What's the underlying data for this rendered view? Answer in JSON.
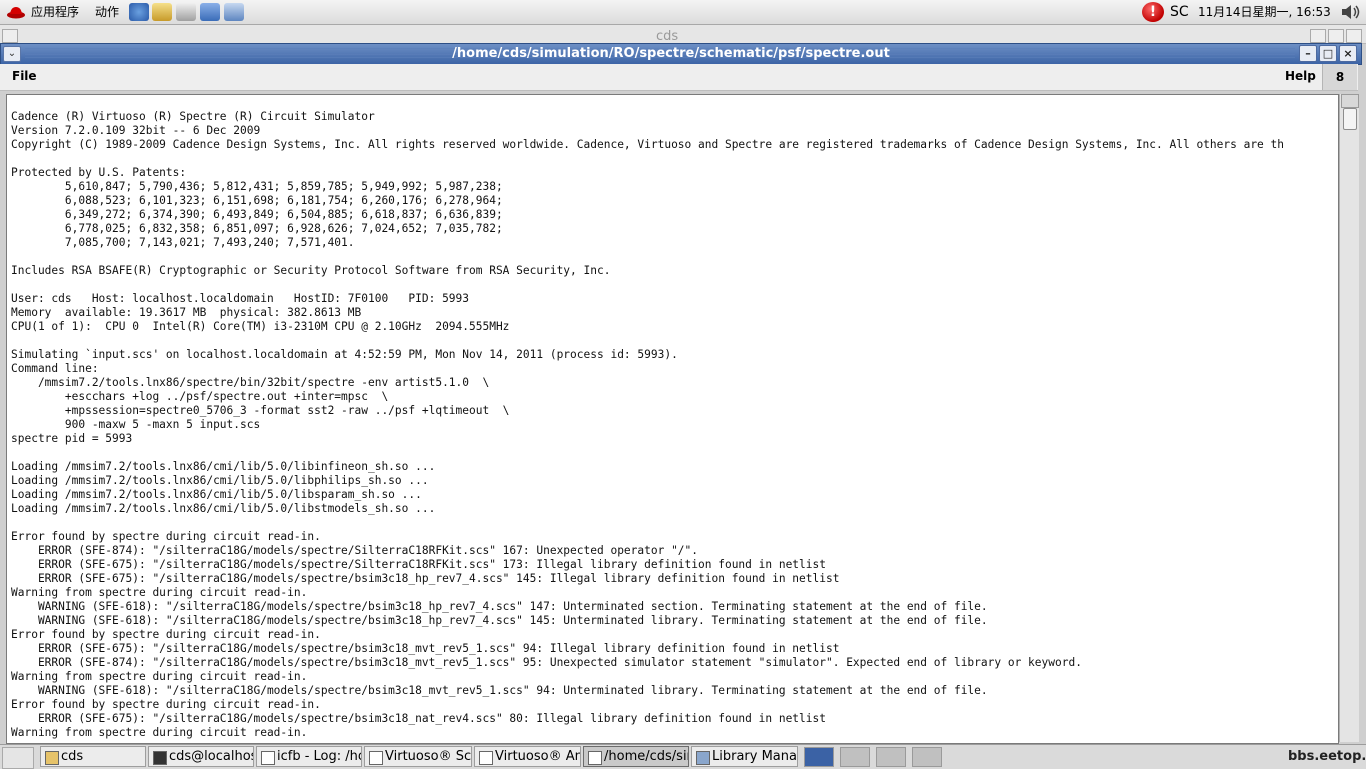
{
  "top_panel": {
    "apps_menu": "应用程序",
    "actions_menu": "动作",
    "status_label": "SC",
    "clock": "11月14日星期一, 16:53"
  },
  "background_window": {
    "title": "cds"
  },
  "window": {
    "title": "/home/cds/simulation/RO/spectre/schematic/psf/spectre.out",
    "menu_file": "File",
    "menu_help": "Help",
    "badge": "8"
  },
  "log": {
    "lines": [
      "Cadence (R) Virtuoso (R) Spectre (R) Circuit Simulator",
      "Version 7.2.0.109 32bit -- 6 Dec 2009",
      "Copyright (C) 1989-2009 Cadence Design Systems, Inc. All rights reserved worldwide. Cadence, Virtuoso and Spectre are registered trademarks of Cadence Design Systems, Inc. All others are th",
      "",
      "Protected by U.S. Patents:",
      "        5,610,847; 5,790,436; 5,812,431; 5,859,785; 5,949,992; 5,987,238;",
      "        6,088,523; 6,101,323; 6,151,698; 6,181,754; 6,260,176; 6,278,964;",
      "        6,349,272; 6,374,390; 6,493,849; 6,504,885; 6,618,837; 6,636,839;",
      "        6,778,025; 6,832,358; 6,851,097; 6,928,626; 7,024,652; 7,035,782;",
      "        7,085,700; 7,143,021; 7,493,240; 7,571,401.",
      "",
      "Includes RSA BSAFE(R) Cryptographic or Security Protocol Software from RSA Security, Inc.",
      "",
      "User: cds   Host: localhost.localdomain   HostID: 7F0100   PID: 5993",
      "Memory  available: 19.3617 MB  physical: 382.8613 MB",
      "CPU(1 of 1):  CPU 0  Intel(R) Core(TM) i3-2310M CPU @ 2.10GHz  2094.555MHz",
      "",
      "Simulating `input.scs' on localhost.localdomain at 4:52:59 PM, Mon Nov 14, 2011 (process id: 5993).",
      "Command line:",
      "    /mmsim7.2/tools.lnx86/spectre/bin/32bit/spectre -env artist5.1.0  \\",
      "        +escchars +log ../psf/spectre.out +inter=mpsc  \\",
      "        +mpssession=spectre0_5706_3 -format sst2 -raw ../psf +lqtimeout  \\",
      "        900 -maxw 5 -maxn 5 input.scs",
      "spectre pid = 5993",
      "",
      "Loading /mmsim7.2/tools.lnx86/cmi/lib/5.0/libinfineon_sh.so ...",
      "Loading /mmsim7.2/tools.lnx86/cmi/lib/5.0/libphilips_sh.so ...",
      "Loading /mmsim7.2/tools.lnx86/cmi/lib/5.0/libsparam_sh.so ...",
      "Loading /mmsim7.2/tools.lnx86/cmi/lib/5.0/libstmodels_sh.so ...",
      "",
      "Error found by spectre during circuit read-in.",
      "    ERROR (SFE-874): \"/silterraC18G/models/spectre/SilterraC18RFKit.scs\" 167: Unexpected operator \"/\".",
      "    ERROR (SFE-675): \"/silterraC18G/models/spectre/SilterraC18RFKit.scs\" 173: Illegal library definition found in netlist",
      "    ERROR (SFE-675): \"/silterraC18G/models/spectre/bsim3c18_hp_rev7_4.scs\" 145: Illegal library definition found in netlist",
      "Warning from spectre during circuit read-in.",
      "    WARNING (SFE-618): \"/silterraC18G/models/spectre/bsim3c18_hp_rev7_4.scs\" 147: Unterminated section. Terminating statement at the end of file.",
      "    WARNING (SFE-618): \"/silterraC18G/models/spectre/bsim3c18_hp_rev7_4.scs\" 145: Unterminated library. Terminating statement at the end of file.",
      "Error found by spectre during circuit read-in.",
      "    ERROR (SFE-675): \"/silterraC18G/models/spectre/bsim3c18_mvt_rev5_1.scs\" 94: Illegal library definition found in netlist",
      "    ERROR (SFE-874): \"/silterraC18G/models/spectre/bsim3c18_mvt_rev5_1.scs\" 95: Unexpected simulator statement \"simulator\". Expected end of library or keyword.",
      "Warning from spectre during circuit read-in.",
      "    WARNING (SFE-618): \"/silterraC18G/models/spectre/bsim3c18_mvt_rev5_1.scs\" 94: Unterminated library. Terminating statement at the end of file.",
      "Error found by spectre during circuit read-in.",
      "    ERROR (SFE-675): \"/silterraC18G/models/spectre/bsim3c18_nat_rev4.scs\" 80: Illegal library definition found in netlist",
      "Warning from spectre during circuit read-in."
    ]
  },
  "taskbar": {
    "tasks": [
      {
        "label": "cds",
        "icon": "folder-icon"
      },
      {
        "label": "cds@localhos",
        "icon": "terminal-icon"
      },
      {
        "label": "icfb - Log: /hor",
        "icon": "window-icon"
      },
      {
        "label": "Virtuoso® Sch",
        "icon": "window-icon"
      },
      {
        "label": "Virtuoso® Ana",
        "icon": "window-icon"
      },
      {
        "label": "/home/cds/sin",
        "icon": "window-icon"
      },
      {
        "label": "Library Manag",
        "icon": "library-icon"
      }
    ],
    "watermark": "bbs.eetop.cn"
  }
}
